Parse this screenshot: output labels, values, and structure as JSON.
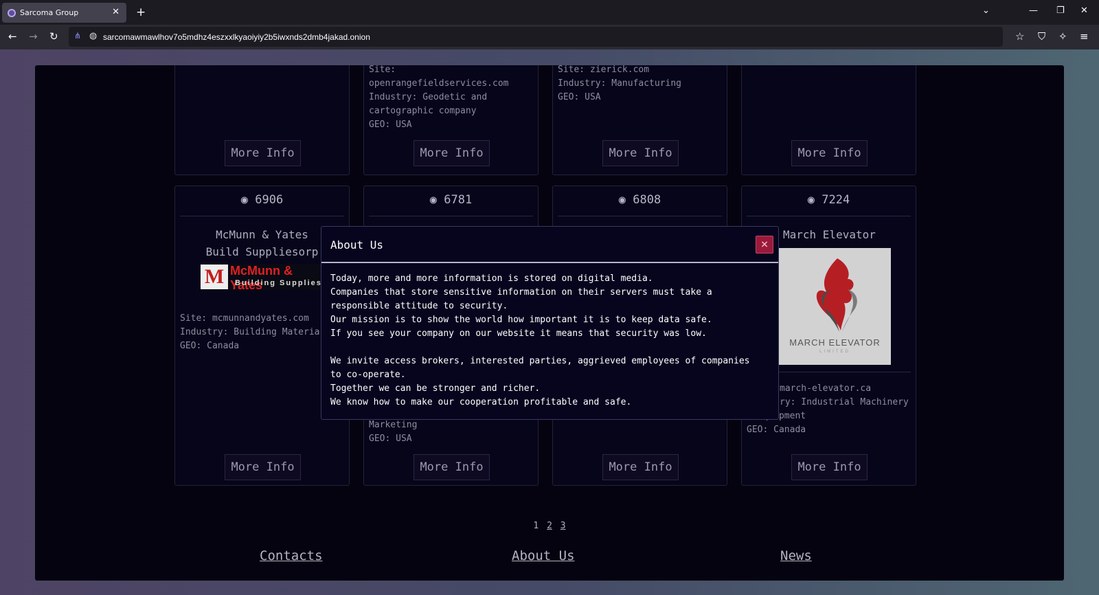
{
  "browser": {
    "tab_title": "Sarcoma Group",
    "url": "sarcomawmawlhov7o5mdhz4eszxxlkyaoiyiy2b5iwxnds2dmb4jakad.onion"
  },
  "cards_top": [
    {
      "info": [],
      "more": "More Info"
    },
    {
      "info": [
        "Site:",
        "openrangefieldservices.com",
        "Industry: Geodetic and",
        "cartographic company",
        "GEO: USA"
      ],
      "more": "More Info"
    },
    {
      "info": [
        "Site: zierick.com",
        "Industry: Manufacturing",
        "GEO: USA"
      ],
      "more": "More Info"
    },
    {
      "info": [],
      "more": "More Info"
    }
  ],
  "cards_bottom": [
    {
      "views": "6906",
      "name": "McMunn & Yates Build Suppliesorp",
      "logo_text1": "McMunn & Yates",
      "logo_text2": "Building Supplies",
      "info": [
        "Site: mcmunnandyates.com",
        "Industry: Building Materia",
        "GEO: Canada"
      ],
      "more": "More Info"
    },
    {
      "views": "6781",
      "info": [
        "Marketing",
        "GEO: USA"
      ],
      "more": "More Info"
    },
    {
      "views": "6808",
      "more": "More Info"
    },
    {
      "views": "7224",
      "name": "March Elevator",
      "logo_text1": "MARCH ELEVATOR",
      "logo_text2": "LIMITED",
      "info": [
        "march-elevator.ca",
        "ry: Industrial Machinery",
        "& Equipment",
        "GEO: Canada"
      ],
      "more": "More Info"
    }
  ],
  "pagination": {
    "pages": [
      "1",
      "2",
      "3"
    ]
  },
  "footer": {
    "contacts": "Contacts",
    "about": "About Us",
    "news": "News"
  },
  "modal": {
    "title": "About Us",
    "close": "×",
    "lines": [
      "Today, more and more information is stored on digital media.",
      "Companies that store sensitive information on their servers must take a",
      "responsible attitude to security.",
      "Our mission is to show the world how important it is to keep data safe.",
      "If you see your company on our website it means that security was low.",
      "",
      "We invite access brokers, interested parties, aggrieved employees of companies",
      "to co-operate.",
      "Together we can be stronger and richer.",
      "We know how to make our cooperation profitable and safe."
    ]
  }
}
